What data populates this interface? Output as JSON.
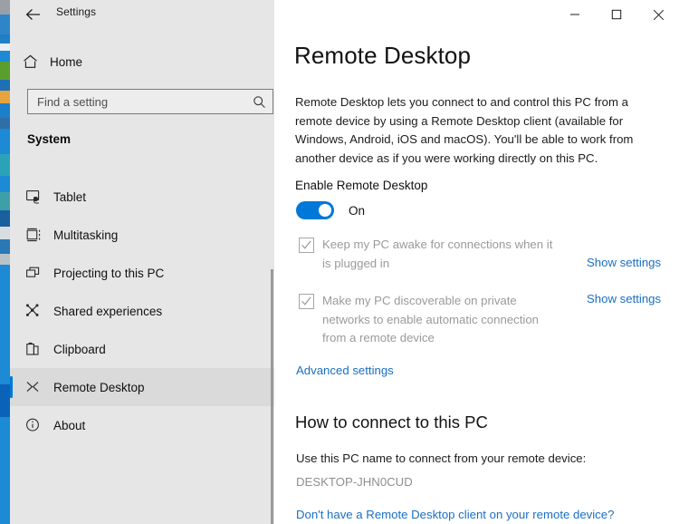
{
  "window": {
    "title": "Settings",
    "back_icon": "back-arrow-icon",
    "minimize_label": "Minimize",
    "maximize_label": "Maximize",
    "close_label": "Close"
  },
  "sidebar": {
    "home_label": "Home",
    "home_icon": "home-icon",
    "search": {
      "placeholder": "Find a setting",
      "value": "",
      "icon": "search-icon"
    },
    "group_title": "System",
    "items": [
      {
        "label": "Tablet",
        "icon": "tablet-icon",
        "selected": false
      },
      {
        "label": "Multitasking",
        "icon": "multitasking-icon",
        "selected": false
      },
      {
        "label": "Projecting to this PC",
        "icon": "projecting-icon",
        "selected": false
      },
      {
        "label": "Shared experiences",
        "icon": "shared-experiences-icon",
        "selected": false
      },
      {
        "label": "Clipboard",
        "icon": "clipboard-icon",
        "selected": false
      },
      {
        "label": "Remote Desktop",
        "icon": "remote-desktop-icon",
        "selected": true
      },
      {
        "label": "About",
        "icon": "info-icon",
        "selected": false
      }
    ]
  },
  "main": {
    "page_title": "Remote Desktop",
    "description": "Remote Desktop lets you connect to and control this PC from a remote device by using a Remote Desktop client (available for Windows, Android, iOS and macOS). You'll be able to work from another device as if you were working directly on this PC.",
    "enable_label": "Enable Remote Desktop",
    "toggle": {
      "state_label": "On",
      "checked": true,
      "accent_color": "#0078d7"
    },
    "options": [
      {
        "label": "Keep my PC awake for connections when it is plugged in",
        "checked": true,
        "disabled": true,
        "link_label": "Show settings"
      },
      {
        "label": "Make my PC discoverable on private networks to enable automatic connection from a remote device",
        "checked": true,
        "disabled": true,
        "link_label": "Show settings"
      }
    ],
    "advanced_settings_label": "Advanced settings",
    "how_to_connect_title": "How to connect to this PC",
    "use_pc_name_label": "Use this PC name to connect from your remote device:",
    "pc_name": "DESKTOP-JHN0CUD",
    "client_link_label": "Don't have a Remote Desktop client on your remote device?"
  },
  "colors": {
    "accent": "#0078d7",
    "link": "#1a6fc4",
    "sidebar_bg": "#e6e6e6",
    "disabled_text": "#9a9a9a"
  }
}
